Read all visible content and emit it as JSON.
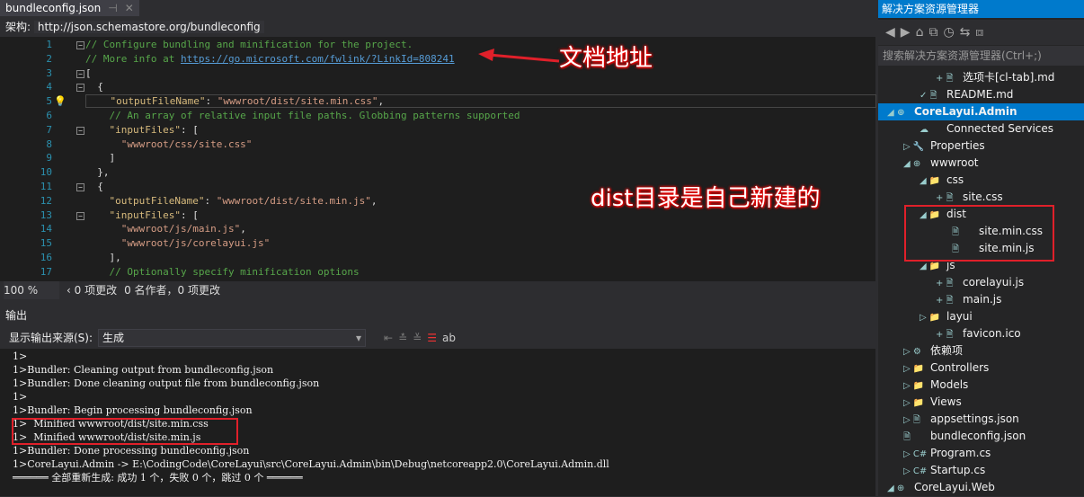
{
  "editor": {
    "tab": "bundleconfig.json",
    "schema_label": "架构:",
    "schema_value": "http://json.schemastore.org/bundleconfig",
    "lines": [
      {
        "n": "1",
        "parts": [
          [
            "cm",
            "// Configure bundling and minification for the project."
          ]
        ]
      },
      {
        "n": "2",
        "parts": [
          [
            "cm",
            "// More info at "
          ],
          [
            "lnk",
            "https://go.microsoft.com/fwlink/?LinkId=808241"
          ]
        ]
      },
      {
        "n": "3",
        "parts": [
          [
            "pn",
            "["
          ]
        ]
      },
      {
        "n": "4",
        "parts": [
          [
            "pn",
            "  {"
          ]
        ]
      },
      {
        "n": "5",
        "parts": [
          [
            "key",
            "    \"outputFileName\""
          ],
          [
            "pn",
            ": "
          ],
          [
            "st",
            "\"wwwroot/dist/site.min.css\""
          ],
          [
            "pn",
            ","
          ]
        ]
      },
      {
        "n": "6",
        "parts": [
          [
            "cm",
            "    // An array of relative input file paths. Globbing patterns supported"
          ]
        ]
      },
      {
        "n": "7",
        "parts": [
          [
            "key",
            "    \"inputFiles\""
          ],
          [
            "pn",
            ": ["
          ]
        ]
      },
      {
        "n": "8",
        "parts": [
          [
            "st",
            "      \"wwwroot/css/site.css\""
          ]
        ]
      },
      {
        "n": "9",
        "parts": [
          [
            "pn",
            "    ]"
          ]
        ]
      },
      {
        "n": "10",
        "parts": [
          [
            "pn",
            "  },"
          ]
        ]
      },
      {
        "n": "11",
        "parts": [
          [
            "pn",
            "  {"
          ]
        ]
      },
      {
        "n": "12",
        "parts": [
          [
            "key",
            "    \"outputFileName\""
          ],
          [
            "pn",
            ": "
          ],
          [
            "st",
            "\"wwwroot/dist/site.min.js\""
          ],
          [
            "pn",
            ","
          ]
        ]
      },
      {
        "n": "13",
        "parts": [
          [
            "key",
            "    \"inputFiles\""
          ],
          [
            "pn",
            ": ["
          ]
        ]
      },
      {
        "n": "14",
        "parts": [
          [
            "st",
            "      \"wwwroot/js/main.js\""
          ],
          [
            "pn",
            ","
          ]
        ]
      },
      {
        "n": "15",
        "parts": [
          [
            "st",
            "      \"wwwroot/js/corelayui.js\""
          ]
        ]
      },
      {
        "n": "16",
        "parts": [
          [
            "pn",
            "    ],"
          ]
        ]
      },
      {
        "n": "17",
        "parts": [
          [
            "cm",
            "    // Optionally specify minification options"
          ]
        ]
      }
    ]
  },
  "status": {
    "zoom": "100 %",
    "changes": "‹ 0 项更改",
    "authors": "0 名作者，0 项更改"
  },
  "output": {
    "title": "输出",
    "source_label": "显示输出来源(S):",
    "source_value": "生成",
    "lines": [
      "1>",
      "1>Bundler: Cleaning output from bundleconfig.json",
      "1>Bundler: Done cleaning output file from bundleconfig.json",
      "1>",
      "1>Bundler: Begin processing bundleconfig.json",
      "1>  Minified wwwroot/dist/site.min.css",
      "1>  Minified wwwroot/dist/site.min.js",
      "1>Bundler: Done processing bundleconfig.json",
      "1>CoreLayui.Admin -> E:\\CodingCode\\CoreLayui\\src\\CoreLayui.Admin\\bin\\Debug\\netcoreapp2.0\\CoreLayui.Admin.dll",
      "══════ 全部重新生成: 成功 1 个，失败 0 个，跳过 0 个 ══════"
    ]
  },
  "solution": {
    "title": "解决方案资源管理器",
    "search_placeholder": "搜索解决方案资源管理器(Ctrl+;)",
    "items": [
      {
        "label": "选项卡[cl-tab].md",
        "indent": 3,
        "icon": "+ 🗎"
      },
      {
        "label": "README.md",
        "indent": 2,
        "icon": "✓ 🗎"
      },
      {
        "label": "CoreLayui.Admin",
        "indent": 0,
        "icon": "◢ ⊕",
        "selected": true
      },
      {
        "label": "Connected Services",
        "indent": 2,
        "icon": "☁"
      },
      {
        "label": "Properties",
        "indent": 1,
        "icon": "▷ 🔧"
      },
      {
        "label": "wwwroot",
        "indent": 1,
        "icon": "◢ ⊕"
      },
      {
        "label": "css",
        "indent": 2,
        "icon": "◢ 📁"
      },
      {
        "label": "site.css",
        "indent": 3,
        "icon": "+ 🗎"
      },
      {
        "label": "dist",
        "indent": 2,
        "icon": "◢ 📁"
      },
      {
        "label": "site.min.css",
        "indent": 4,
        "icon": "🗎"
      },
      {
        "label": "site.min.js",
        "indent": 4,
        "icon": "🗎"
      },
      {
        "label": "js",
        "indent": 2,
        "icon": "◢ 📁"
      },
      {
        "label": "corelayui.js",
        "indent": 3,
        "icon": "+ 🗎"
      },
      {
        "label": "main.js",
        "indent": 3,
        "icon": "+ 🗎"
      },
      {
        "label": "layui",
        "indent": 2,
        "icon": "▷ 📁"
      },
      {
        "label": "favicon.ico",
        "indent": 3,
        "icon": "+ 🗎"
      },
      {
        "label": "依赖项",
        "indent": 1,
        "icon": "▷ ⚙"
      },
      {
        "label": "Controllers",
        "indent": 1,
        "icon": "▷ 📁"
      },
      {
        "label": "Models",
        "indent": 1,
        "icon": "▷ 📁"
      },
      {
        "label": "Views",
        "indent": 1,
        "icon": "▷ 📁"
      },
      {
        "label": "appsettings.json",
        "indent": 1,
        "icon": "▷ 🗎"
      },
      {
        "label": "bundleconfig.json",
        "indent": 1,
        "icon": "🗎"
      },
      {
        "label": "Program.cs",
        "indent": 1,
        "icon": "▷ C#"
      },
      {
        "label": "Startup.cs",
        "indent": 1,
        "icon": "▷ C#"
      },
      {
        "label": "CoreLayui.Web",
        "indent": 0,
        "icon": "◢ ⊕"
      }
    ]
  },
  "annotations": {
    "doc": "文档地址",
    "dist": "dist目录是自己新建的"
  }
}
